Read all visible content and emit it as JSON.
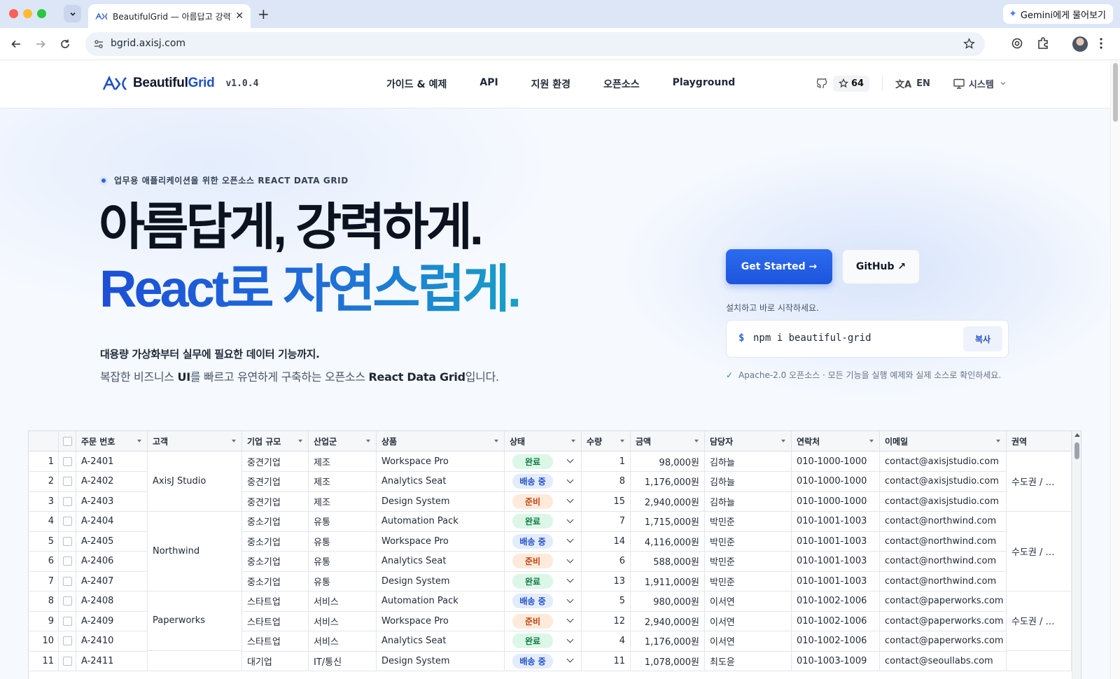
{
  "browser": {
    "tab_title": "BeautifulGrid — 아름답고 강력한 React Data Grid",
    "url": "bgrid.axisj.com",
    "gemini_label": "Gemini에게 물어보기"
  },
  "header": {
    "brand_prefix": "Beautiful",
    "brand_suffix": "Grid",
    "version": "v1.0.4",
    "nav": [
      "가이드 & 예제",
      "API",
      "지원 환경",
      "오픈소스",
      "Playground"
    ],
    "stars": "64",
    "lang": "EN",
    "theme": "시스템"
  },
  "hero": {
    "eyebrow": "업무용 애플리케이션을 위한 오픈소스 REACT DATA GRID",
    "title_line1": "아름답게, 강력하게.",
    "title_line2": "React로 자연스럽게.",
    "subtitle": "대용량 가상화부터 실무에 필요한 데이터 기능까지.",
    "desc_pre": "복잡한 비즈니스 ",
    "desc_ui": "UI",
    "desc_mid": "를 빠르고 유연하게 구축하는 오픈소스 ",
    "desc_bold": "React Data Grid",
    "desc_post": "입니다.",
    "cta_primary": "Get Started →",
    "cta_secondary": "GitHub ↗",
    "install_label": "설치하고 바로 시작하세요.",
    "install_prompt": "$",
    "install_cmd": "npm i beautiful-grid",
    "copy_label": "복사",
    "license": "Apache-2.0 오픈소스 · 모든 기능을 실행 예제와 실제 소스로 확인하세요."
  },
  "grid": {
    "columns": [
      "",
      "",
      "주문 번호",
      "고객",
      "기업 규모",
      "산업군",
      "상품",
      "상태",
      "수량",
      "금액",
      "담당자",
      "연락처",
      "이메일",
      "권역"
    ],
    "rows": [
      [
        "1",
        "A-2401",
        "중견기업",
        "제조",
        "Workspace Pro",
        "완료",
        "1",
        "98,000원",
        "김하늘",
        "010-1000-1000",
        "contact@axisjstudio.com"
      ],
      [
        "2",
        "A-2402",
        "중견기업",
        "제조",
        "Analytics Seat",
        "배송 중",
        "8",
        "1,176,000원",
        "김하늘",
        "010-1000-1000",
        "contact@axisjstudio.com"
      ],
      [
        "3",
        "A-2403",
        "중견기업",
        "제조",
        "Design System",
        "준비",
        "15",
        "2,940,000원",
        "김하늘",
        "010-1000-1000",
        "contact@axisjstudio.com"
      ],
      [
        "4",
        "A-2404",
        "중소기업",
        "유통",
        "Automation Pack",
        "완료",
        "7",
        "1,715,000원",
        "박민준",
        "010-1001-1003",
        "contact@northwind.com"
      ],
      [
        "5",
        "A-2405",
        "중소기업",
        "유통",
        "Workspace Pro",
        "배송 중",
        "14",
        "4,116,000원",
        "박민준",
        "010-1001-1003",
        "contact@northwind.com"
      ],
      [
        "6",
        "A-2406",
        "중소기업",
        "유통",
        "Analytics Seat",
        "준비",
        "6",
        "588,000원",
        "박민준",
        "010-1001-1003",
        "contact@northwind.com"
      ],
      [
        "7",
        "A-2407",
        "중소기업",
        "유통",
        "Design System",
        "완료",
        "13",
        "1,911,000원",
        "박민준",
        "010-1001-1003",
        "contact@northwind.com"
      ],
      [
        "8",
        "A-2408",
        "스타트업",
        "서비스",
        "Automation Pack",
        "배송 중",
        "5",
        "980,000원",
        "이서연",
        "010-1002-1006",
        "contact@paperworks.com"
      ],
      [
        "9",
        "A-2409",
        "스타트업",
        "서비스",
        "Workspace Pro",
        "준비",
        "12",
        "2,940,000원",
        "이서연",
        "010-1002-1006",
        "contact@paperworks.com"
      ],
      [
        "10",
        "A-2410",
        "스타트업",
        "서비스",
        "Analytics Seat",
        "완료",
        "4",
        "1,176,000원",
        "이서연",
        "010-1002-1006",
        "contact@paperworks.com"
      ],
      [
        "11",
        "A-2411",
        "대기업",
        "IT/통신",
        "Design System",
        "배송 중",
        "11",
        "1,078,000원",
        "최도윤",
        "010-1003-1009",
        "contact@seoullabs.com"
      ]
    ],
    "customers": [
      {
        "name": "AxisJ Studio",
        "start": 0,
        "span": 3
      },
      {
        "name": "Northwind",
        "start": 3,
        "span": 4
      },
      {
        "name": "Paperworks",
        "start": 7,
        "span": 3
      },
      {
        "name": "",
        "start": 10,
        "span": 1
      }
    ],
    "regions": [
      {
        "name": "수도권 / …",
        "start": 0,
        "span": 3
      },
      {
        "name": "수도권 / …",
        "start": 3,
        "span": 4
      },
      {
        "name": "수도권 / …",
        "start": 7,
        "span": 3
      },
      {
        "name": "",
        "start": 10,
        "span": 1
      }
    ],
    "status_colors": {
      "완료": "#0d7a45",
      "배송 중": "#1f4fc9",
      "준비": "#c2410c"
    }
  }
}
